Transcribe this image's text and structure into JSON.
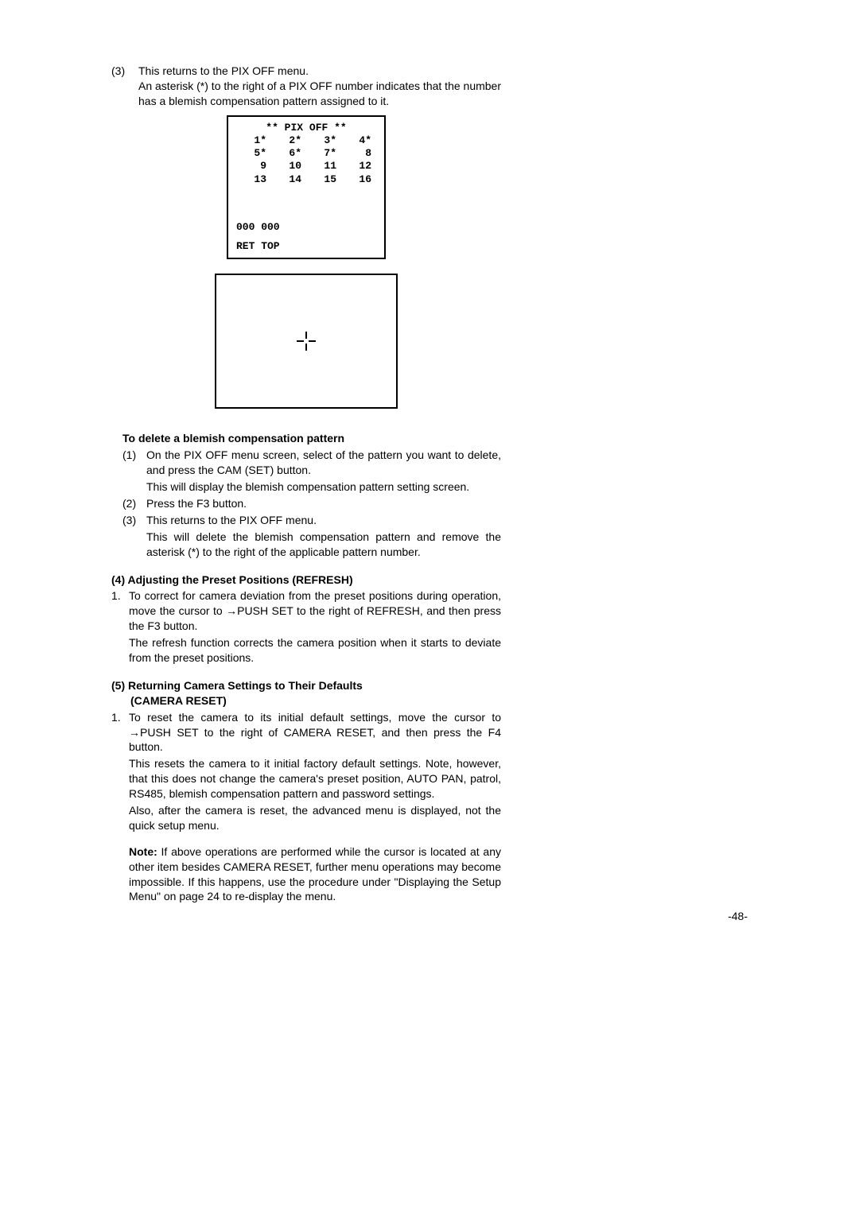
{
  "top": {
    "num": "(3)",
    "line1": "This returns to the PIX OFF menu.",
    "line2": "An asterisk (*) to the right of a PIX OFF number indicates that the number has a blemish compensation pattern assigned to it."
  },
  "pix_menu": {
    "title": "** PIX OFF **",
    "rows": [
      [
        " 1*",
        " 2*",
        " 3*",
        " 4*"
      ],
      [
        " 5*",
        " 6*",
        " 7*",
        " 8 "
      ],
      [
        " 9 ",
        "10 ",
        "11 ",
        "12 "
      ],
      [
        "13 ",
        "14 ",
        "15 ",
        "16 "
      ]
    ],
    "coords": "000 000",
    "ret": "RET TOP"
  },
  "delete": {
    "heading": "To delete a blemish compensation pattern",
    "i1num": "(1)",
    "i1a": "On the PIX OFF menu screen, select of the pattern you want to delete, and press the CAM (SET) button.",
    "i1b": "This will display the blemish compensation pattern setting screen.",
    "i2num": "(2)",
    "i2": "Press the F3 button.",
    "i3num": "(3)",
    "i3a": "This returns to the PIX OFF menu.",
    "i3b": "This will delete the blemish compensation pattern and remove the asterisk (*) to the right of the applicable pattern number."
  },
  "sec4": {
    "heading": "(4) Adjusting the Preset Positions (REFRESH)",
    "num": "1.",
    "p1": "To correct for camera deviation from the preset positions during operation, move the cursor to →PUSH SET to the right of REFRESH, and then press the F3 button.",
    "p2": "The refresh function corrects the camera position when it starts to deviate from the preset positions."
  },
  "sec5": {
    "heading1": "(5) Returning Camera Settings to Their Defaults",
    "heading2": "(CAMERA RESET)",
    "num": "1.",
    "p1": "To reset the camera to its initial default settings, move the cursor to →PUSH SET to the right of CAMERA RESET, and then press the F4 button.",
    "p2": "This resets the camera to it initial factory default settings. Note, however, that this does not change the camera's preset position, AUTO PAN, patrol, RS485, blemish compensation pattern and password settings.",
    "p3": "Also, after the camera is reset, the advanced menu is displayed, not the quick setup menu.",
    "note_label": "Note:",
    "note": " If above operations are performed while the cursor is located at any other item besides CAMERA RESET, further menu operations may become impossible. If this happens, use the procedure under \"Displaying the Setup Menu\" on page 24 to re-display the menu."
  },
  "pagenum": "-48-"
}
